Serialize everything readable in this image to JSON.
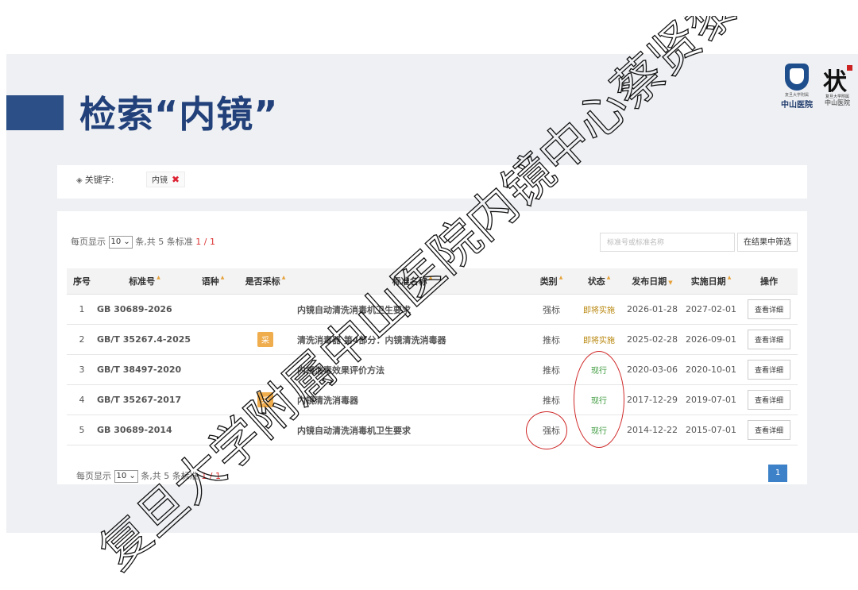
{
  "slide": {
    "title": "检索“内镜”"
  },
  "logos": {
    "hospital_small_text": "复旦大学附属",
    "hospital_name": "中山医院",
    "right_logo_text": "复旦大学附属",
    "right_logo_name": "中山医院"
  },
  "keyword": {
    "label": "关键字:",
    "tag": "内镜",
    "remove_icon": "close-icon"
  },
  "pager": {
    "prefix": "每页显示",
    "page_size": "10",
    "suffix_top": "条,共 5 条标准",
    "suffix_bottom": "条,共 5 条标准",
    "page_info": "1 / 1",
    "current_page": "1"
  },
  "filter": {
    "placeholder": "标准号或标准名称",
    "button": "在结果中筛选"
  },
  "table": {
    "headers": [
      "序号",
      "标准号",
      "语种",
      "是否采标",
      "标准名称",
      "类别",
      "状态",
      "发布日期",
      "实施日期",
      "操作"
    ],
    "rows": [
      {
        "no": "1",
        "code": "GB 30689-2026",
        "lang": "",
        "adopt": "",
        "name": "内镜自动清洗消毒机卫生要求",
        "category": "强标",
        "status": "即将实施",
        "publish": "2026-01-28",
        "implement": "2027-02-01",
        "action": "查看详细"
      },
      {
        "no": "2",
        "code": "GB/T 35267.4-2025",
        "lang": "",
        "adopt": "采",
        "name": "清洗消毒器 第4部分：内镜清洗消毒器",
        "category": "推标",
        "status": "即将实施",
        "publish": "2025-02-28",
        "implement": "2026-09-01",
        "action": "查看详细"
      },
      {
        "no": "3",
        "code": "GB/T 38497-2020",
        "lang": "",
        "adopt": "",
        "name": "内镜消毒效果评价方法",
        "category": "推标",
        "status": "现行",
        "publish": "2020-03-06",
        "implement": "2020-10-01",
        "action": "查看详细"
      },
      {
        "no": "4",
        "code": "GB/T 35267-2017",
        "lang": "",
        "adopt": "采",
        "name": "内镜清洗消毒器",
        "category": "推标",
        "status": "现行",
        "publish": "2017-12-29",
        "implement": "2019-07-01",
        "action": "查看详细"
      },
      {
        "no": "5",
        "code": "GB 30689-2014",
        "lang": "",
        "adopt": "",
        "name": "内镜自动清洗消毒机卫生要求",
        "category": "强标",
        "status": "现行",
        "publish": "2014-12-22",
        "implement": "2015-07-01",
        "action": "查看详细"
      }
    ]
  },
  "watermark": {
    "text": "复旦大学附属中山医院内镜中心蔡贤黎"
  },
  "colors": {
    "title": "#22417a",
    "accent_bar": "#2b4f86",
    "link": "#1f6fc2",
    "badge": "#f0ad4e",
    "status_now": "#3c9a3c",
    "status_soon": "#b8860b",
    "annotation_circle": "#d02828",
    "page_active": "#3d82c9"
  }
}
